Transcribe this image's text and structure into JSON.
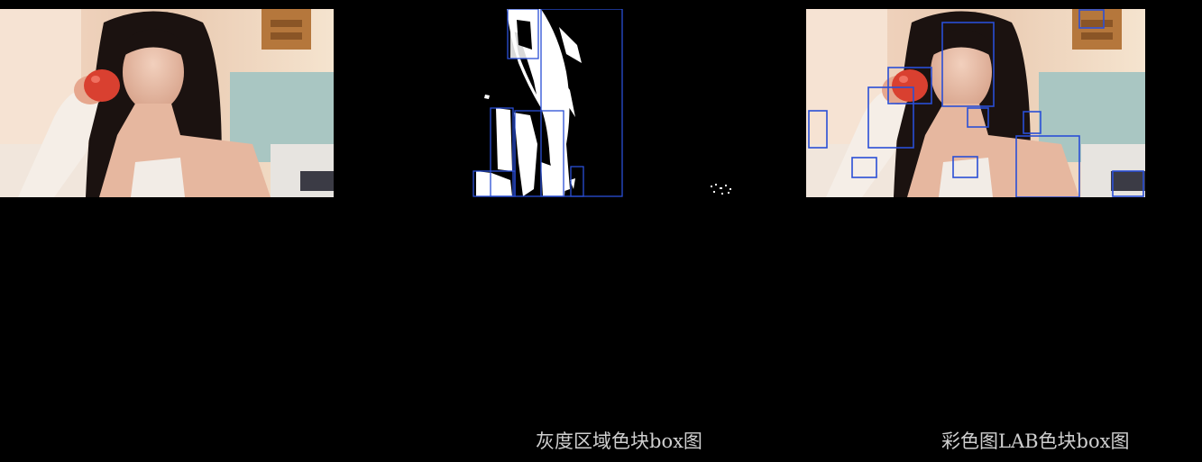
{
  "captions": {
    "gray": "灰度区域色块box图",
    "lab": "彩色图LAB色块box图"
  },
  "colors": {
    "background": "#000000",
    "box": "#2a4fd6",
    "caption": "#cfcfcf"
  },
  "panels": {
    "original": {
      "name": "original-photo"
    },
    "gray": {
      "name": "grayscale-blob-boxes"
    },
    "lab": {
      "name": "lab-color-blob-boxes"
    }
  }
}
